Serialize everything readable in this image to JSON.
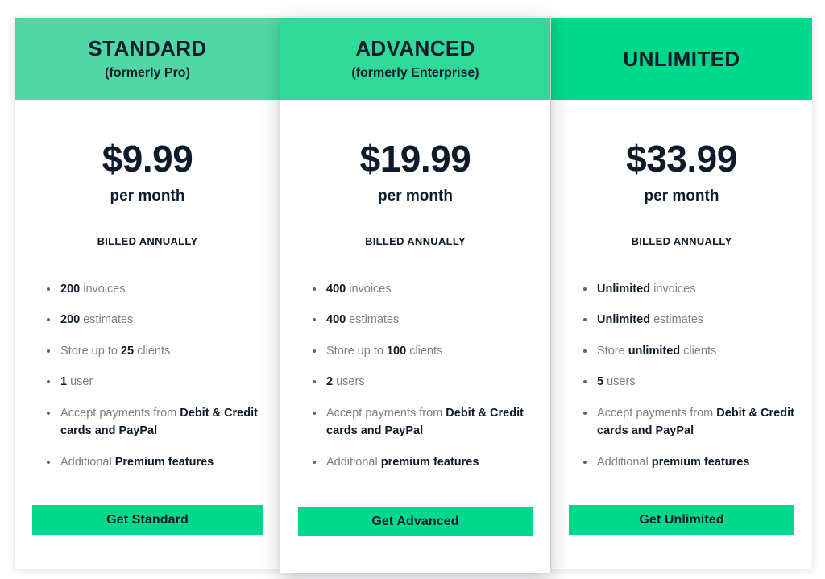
{
  "page": {
    "background": "#ffffff",
    "text_dark": "#0d1b2a",
    "text_muted": "#7a7f87"
  },
  "plans": [
    {
      "id": "standard",
      "name": "STANDARD",
      "former": "(formerly Pro)",
      "header_color": "#4fd8a5",
      "price": "$9.99",
      "period": "per month",
      "billing_note": "BILLED ANNUALLY",
      "features": [
        [
          {
            "t": "200",
            "b": true
          },
          {
            "t": " invoices",
            "b": false
          }
        ],
        [
          {
            "t": "200",
            "b": true
          },
          {
            "t": " estimates",
            "b": false
          }
        ],
        [
          {
            "t": "Store up to ",
            "b": false
          },
          {
            "t": "25",
            "b": true
          },
          {
            "t": " clients",
            "b": false
          }
        ],
        [
          {
            "t": "1",
            "b": true
          },
          {
            "t": " user",
            "b": false
          }
        ],
        [
          {
            "t": "Accept payments from ",
            "b": false
          },
          {
            "t": "Debit & Credit cards and PayPal",
            "b": true
          }
        ],
        [
          {
            "t": "Additional ",
            "b": false
          },
          {
            "t": "Premium features",
            "b": true
          }
        ]
      ],
      "cta_label": "Get Standard",
      "cta_color": "#00d98b"
    },
    {
      "id": "advanced",
      "name": "ADVANCED",
      "former": "(formerly Enterprise)",
      "header_color": "#2ed99a",
      "price": "$19.99",
      "period": "per month",
      "billing_note": "BILLED ANNUALLY",
      "features": [
        [
          {
            "t": "400",
            "b": true
          },
          {
            "t": " invoices",
            "b": false
          }
        ],
        [
          {
            "t": "400",
            "b": true
          },
          {
            "t": " estimates",
            "b": false
          }
        ],
        [
          {
            "t": "Store up to ",
            "b": false
          },
          {
            "t": "100",
            "b": true
          },
          {
            "t": " clients",
            "b": false
          }
        ],
        [
          {
            "t": "2",
            "b": true
          },
          {
            "t": " users",
            "b": false
          }
        ],
        [
          {
            "t": "Accept payments from ",
            "b": false
          },
          {
            "t": "Debit & Credit cards and PayPal",
            "b": true
          }
        ],
        [
          {
            "t": "Additional ",
            "b": false
          },
          {
            "t": "premium features",
            "b": true
          }
        ]
      ],
      "cta_label": "Get Advanced",
      "cta_color": "#00d98b"
    },
    {
      "id": "unlimited",
      "name": "UNLIMITED",
      "former": "",
      "header_color": "#00d98b",
      "price": "$33.99",
      "period": "per month",
      "billing_note": "BILLED ANNUALLY",
      "features": [
        [
          {
            "t": "Unlimited",
            "b": true
          },
          {
            "t": " invoices",
            "b": false
          }
        ],
        [
          {
            "t": "Unlimited",
            "b": true
          },
          {
            "t": " estimates",
            "b": false
          }
        ],
        [
          {
            "t": "Store ",
            "b": false
          },
          {
            "t": "unlimited",
            "b": true
          },
          {
            "t": " clients",
            "b": false
          }
        ],
        [
          {
            "t": "5",
            "b": true
          },
          {
            "t": " users",
            "b": false
          }
        ],
        [
          {
            "t": "Accept payments from ",
            "b": false
          },
          {
            "t": "Debit & Credit cards and PayPal",
            "b": true
          }
        ],
        [
          {
            "t": "Additional ",
            "b": false
          },
          {
            "t": "premium features",
            "b": true
          }
        ]
      ],
      "cta_label": "Get Unlimited",
      "cta_color": "#00d98b"
    }
  ]
}
